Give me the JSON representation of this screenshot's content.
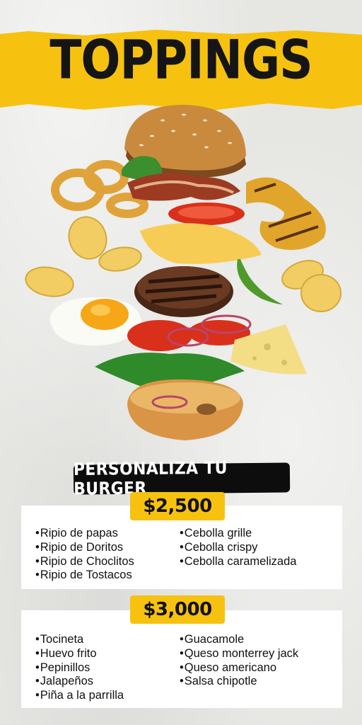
{
  "header": {
    "title": "TOPPINGS"
  },
  "illustration": {
    "subject": "burger-exploded-icon",
    "accent": "#f6c20f"
  },
  "banner": {
    "label": "PERSONALIZA TU BURGER"
  },
  "tiers": [
    {
      "price": "$2,500",
      "left": [
        "Ripio de papas",
        "Ripio de Doritos",
        "Ripio de Choclitos",
        "Ripio de Tostacos"
      ],
      "right": [
        "Cebolla grille",
        "Cebolla crispy",
        "Cebolla caramelizada"
      ]
    },
    {
      "price": "$3,000",
      "left": [
        "Tocineta",
        "Huevo frito",
        "Pepinillos",
        "Jalapeños",
        "Piña a la parrilla"
      ],
      "right": [
        "Guacamole",
        "Queso monterrey jack",
        "Queso americano",
        "Salsa chipotle"
      ]
    }
  ],
  "colors": {
    "yellow": "#f6c20f",
    "black": "#0d0d0d",
    "background": "#e6e6e3"
  }
}
